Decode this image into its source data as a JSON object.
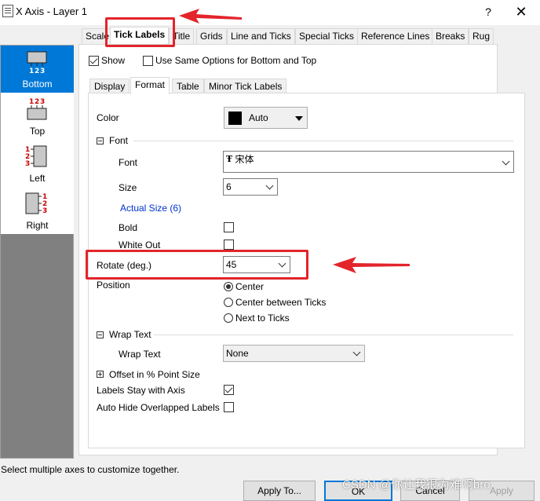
{
  "window": {
    "title": "X Axis - Layer 1",
    "help": "?",
    "close": "✕"
  },
  "axis_list": [
    {
      "label": "Bottom",
      "selected": true,
      "icon": "axis-bottom-icon"
    },
    {
      "label": "Top",
      "selected": false,
      "icon": "axis-top-icon"
    },
    {
      "label": "Left",
      "selected": false,
      "icon": "axis-left-icon"
    },
    {
      "label": "Right",
      "selected": false,
      "icon": "axis-right-icon"
    }
  ],
  "axis_icon_digits": [
    "1",
    "2",
    "3"
  ],
  "tabs": [
    "Scale",
    "Tick Labels",
    "Title",
    "Grids",
    "Line and Ticks",
    "Special Ticks",
    "Reference Lines",
    "Breaks",
    "Rug"
  ],
  "active_tab": "Tick Labels",
  "show": {
    "label": "Show",
    "checked": true
  },
  "same_options": {
    "label": "Use Same Options for Bottom and Top",
    "checked": false
  },
  "subtabs": [
    "Display",
    "Format",
    "Table",
    "Minor Tick Labels"
  ],
  "active_subtab": "Format",
  "format": {
    "color_label": "Color",
    "color_value": "Auto",
    "font_group": "Font",
    "font_label": "Font",
    "font_value": "宋体",
    "font_type_icon": "Ŧ",
    "size_label": "Size",
    "size_value": "6",
    "actual_size": "Actual Size (6)",
    "bold_label": "Bold",
    "bold_checked": false,
    "whiteout_label": "White Out",
    "whiteout_checked": false,
    "rotate_label": "Rotate (deg.)",
    "rotate_value": "45",
    "position_label": "Position",
    "position_options": [
      "Center",
      "Center between Ticks",
      "Next to Ticks"
    ],
    "position_selected": "Center",
    "wrap_group": "Wrap Text",
    "wrap_label": "Wrap Text",
    "wrap_value": "None",
    "offset_group": "Offset in % Point Size",
    "stay_label": "Labels Stay with Axis",
    "stay_checked": true,
    "autohide_label": "Auto Hide Overlapped Labels",
    "autohide_checked": false
  },
  "status": "Select multiple axes to customize together.",
  "buttons": {
    "apply_to": "Apply To...",
    "ok": "OK",
    "cancel": "Cancel",
    "apply": "Apply"
  },
  "watermark": "CSDN @你让我很为难啊bro",
  "colors": {
    "selection": "#0078d7",
    "annotation": "#e3242b",
    "color_swatch": "#000000"
  }
}
